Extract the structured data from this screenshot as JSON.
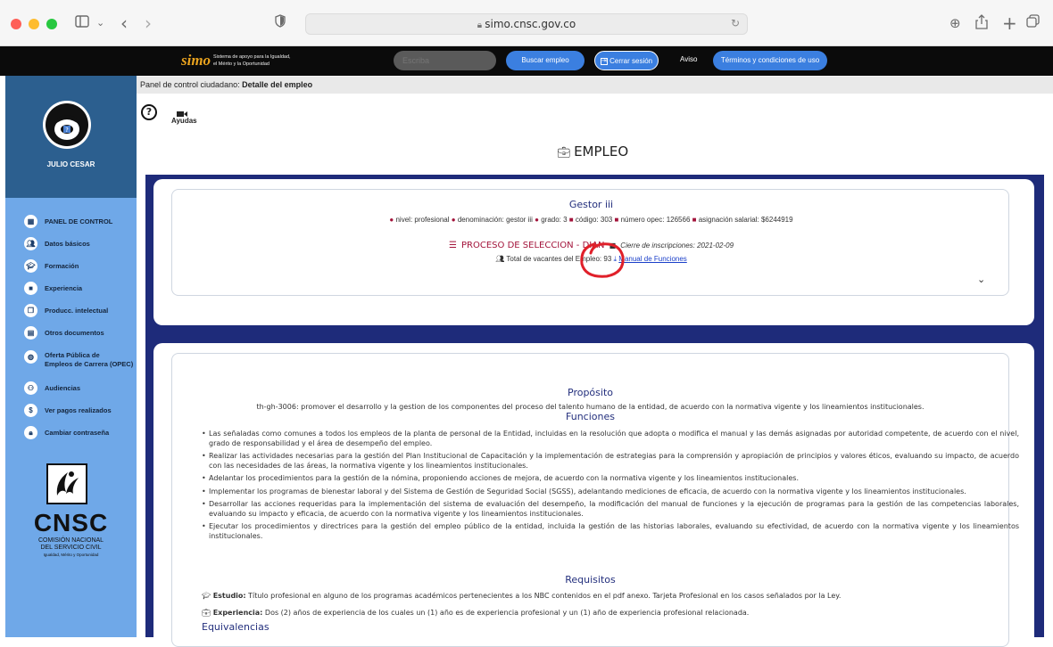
{
  "browser": {
    "url": "simo.cnsc.gov.co"
  },
  "topnav": {
    "brand_logo": "simo",
    "brand_tagline_1": "Sistema de apoyo para la Igualdad,",
    "brand_tagline_2": "el Mérito y la Oportunidad",
    "search_placeholder": "Escriba",
    "buscar_label": "Buscar empleo",
    "cerrar_label": "Cerrar sesión",
    "aviso_label": "Aviso",
    "terminos_label": "Términos y condiciones de uso"
  },
  "sidebar": {
    "user_name": "JULIO CESAR",
    "items": [
      {
        "label": "PANEL DE CONTROL",
        "icon": "dashboard-icon"
      },
      {
        "label": "Datos básicos",
        "icon": "users-icon"
      },
      {
        "label": "Formación",
        "icon": "graduation-icon"
      },
      {
        "label": "Experiencia",
        "icon": "briefcase-icon"
      },
      {
        "label": "Producc. intelectual",
        "icon": "copy-icon"
      },
      {
        "label": "Otros documentos",
        "icon": "file-icon"
      },
      {
        "label": "Oferta Pública de",
        "label2": "Empleos de Carrera (OPEC)",
        "icon": "globe-icon"
      },
      {
        "label": "Audiencias",
        "icon": "group-icon"
      },
      {
        "label": "Ver pagos realizados",
        "icon": "dollar-icon"
      },
      {
        "label": "Cambiar contraseña",
        "icon": "lock-icon"
      }
    ],
    "logo": {
      "acronym": "CNSC",
      "line1": "COMISIÓN NACIONAL",
      "line2": "DEL SERVICIO CIVIL",
      "line3": "Igualdad, Mérito y Oportunidad"
    }
  },
  "breadcrumb": {
    "prefix": "Panel de control ciudadano: ",
    "current": "Detalle del empleo"
  },
  "help": {
    "label": "Ayudas"
  },
  "page_title": "EMPLEO",
  "job": {
    "title": "Gestor iii",
    "nivel": "nivel: profesional",
    "denominacion": "denominación: gestor iii",
    "grado": "grado: 3",
    "codigo": "código: 303",
    "opec": "número opec: 126566",
    "asignacion": "asignación salarial: $6244919",
    "proceso": "PROCESO DE SELECCION - DIAN",
    "cierre": "Cierre de inscripciones: 2021-02-09",
    "vacantes": "Total de vacantes del Empleo: 93",
    "manual_link": "Manual de Funciones"
  },
  "detail": {
    "proposito_title": "Propósito",
    "proposito_text": "th-gh-3006: promover el desarrollo y la gestion de los componentes del proceso del talento humano de la entidad, de acuerdo con la normativa vigente y los lineamientos institucionales.",
    "funciones_title": "Funciones",
    "funciones": [
      "Las señaladas como comunes a todos los empleos de la planta de personal de la Entidad, incluidas en la resolución que adopta o modifica el manual y las demás asignadas por autoridad competente, de acuerdo con el nivel, grado de responsabilidad y el área de desempeño del empleo.",
      "Realizar las actividades necesarias para la gestión del Plan Institucional de Capacitación y la implementación de estrategias para la comprensión y apropiación de principios y valores éticos, evaluando su impacto, de acuerdo con las necesidades de las áreas, la normativa vigente y los lineamientos institucionales.",
      "Adelantar los procedimientos para la gestión de la nómina, proponiendo acciones de mejora, de acuerdo con la normativa vigente y los lineamientos institucionales.",
      "Implementar los programas de bienestar laboral y del Sistema de Gestión de Seguridad Social (SGSS), adelantando mediciones de eficacia, de acuerdo con la normativa vigente y los lineamientos institucionales.",
      "Desarrollar las acciones requeridas para la implementación del sistema de evaluación del desempeño, la modificación del manual de funciones y la ejecución de programas para la gestión de las competencias laborales, evaluando su impacto y eficacia, de acuerdo con la normativa vigente y los lineamientos institucionales.",
      "Ejecutar los procedimientos y directrices para la gestión del empleo público de la entidad, incluida la gestión de las historias laborales, evaluando su efectividad, de acuerdo con la normativa vigente y los lineamientos institucionales."
    ],
    "requisitos_title": "Requisitos",
    "estudio_label": "Estudio:",
    "estudio_text": " Título profesional en alguno de los programas académicos pertenecientes a los NBC contenidos en el pdf anexo. Tarjeta Profesional en los casos señalados por la Ley.",
    "experiencia_label": "Experiencia:",
    "experiencia_text": " Dos (2) años de experiencia de los cuales un (1) año es de experiencia profesional y un (1) año de experiencia profesional relacionada.",
    "equivalencias_title": "Equivalencias"
  },
  "colors": {
    "navy": "#1e2b7a",
    "sidebar": "#6fa8e8",
    "sidebar_head": "#2c5f8f",
    "accent_red": "#a3143b",
    "annotation_red": "#e0202a"
  }
}
